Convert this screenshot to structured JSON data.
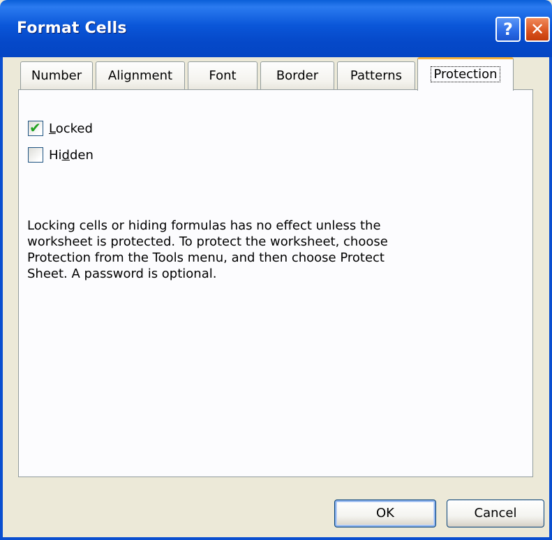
{
  "window": {
    "title": "Format Cells",
    "help_glyph": "?",
    "close_glyph": "✕"
  },
  "tabs": [
    {
      "label": "Number",
      "active": false
    },
    {
      "label": "Alignment",
      "active": false
    },
    {
      "label": "Font",
      "active": false
    },
    {
      "label": "Border",
      "active": false
    },
    {
      "label": "Patterns",
      "active": false
    },
    {
      "label": "Protection",
      "active": true
    }
  ],
  "protection": {
    "locked": {
      "label_accel": "L",
      "label_rest": "ocked",
      "checked": true
    },
    "hidden": {
      "label_pre": "Hi",
      "label_accel": "d",
      "label_rest": "den",
      "checked": false
    },
    "info_text": "Locking cells or hiding formulas has no effect unless the worksheet is protected. To protect the worksheet, choose Protection from the Tools menu, and then choose Protect Sheet. A password is optional."
  },
  "buttons": {
    "ok_label": "OK",
    "cancel_label": "Cancel"
  },
  "colors": {
    "titlebar": "#0a56d8",
    "active_tab_accent": "#f7b33d",
    "check_mark": "#21a121",
    "dialog_background": "#ece9d8"
  }
}
